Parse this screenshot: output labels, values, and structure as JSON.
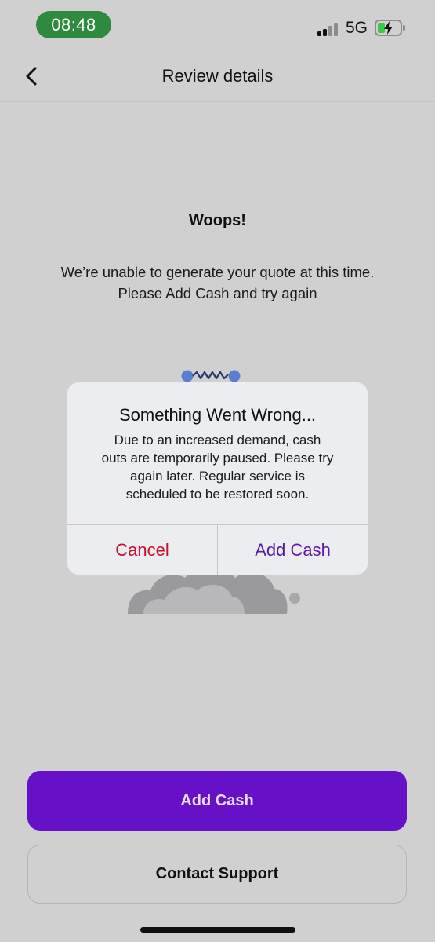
{
  "status_bar": {
    "time": "08:48",
    "network": "5G",
    "signal_bars_active": 2,
    "signal_bars_total": 4,
    "battery_state": "charging",
    "time_pill_color": "#2e8a3e"
  },
  "header": {
    "title": "Review details",
    "back_icon": "chevron-left-icon"
  },
  "error": {
    "title": "Woops!",
    "message_lines": [
      "We’re unable to generate your quote at this time.",
      "Please Add Cash and try again"
    ]
  },
  "illustration": {
    "icon": "broken-cable-cloud-illustration"
  },
  "dialog": {
    "title": "Something Went Wrong...",
    "message_lines": [
      "Due to an increased demand, cash",
      "outs are temporarily paused. Please try",
      "again later. Regular service is",
      "scheduled to be restored soon."
    ],
    "cancel_label": "Cancel",
    "confirm_label": "Add Cash",
    "cancel_color": "#c8102e",
    "confirm_color": "#5b1aa8"
  },
  "actions": {
    "primary_label": "Add Cash",
    "secondary_label": "Contact Support",
    "primary_color": "#6610c8"
  }
}
